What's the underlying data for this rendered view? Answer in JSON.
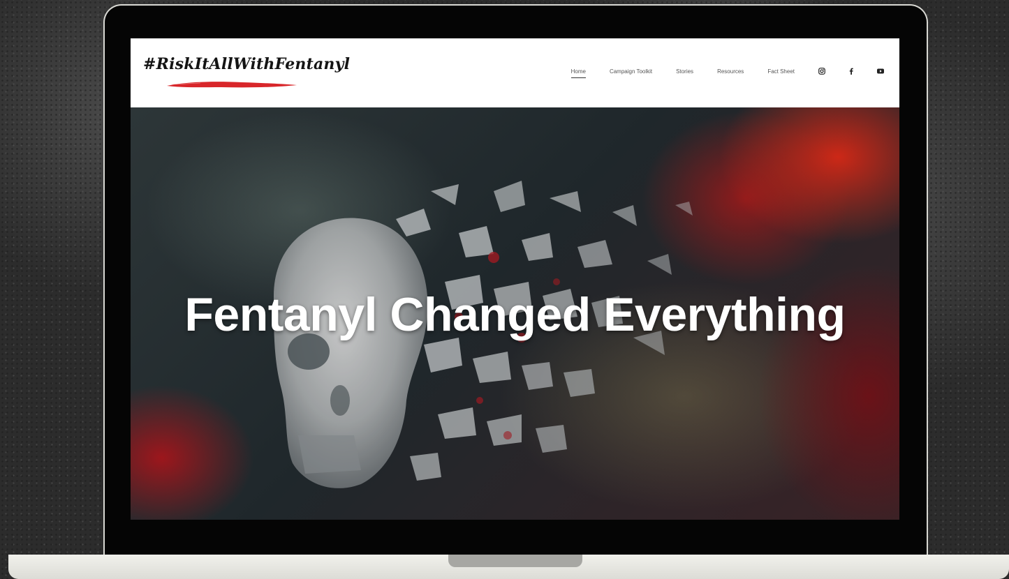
{
  "site": {
    "logo_text": "#RiskItAllWithFentanyl",
    "accent": "#d8262a"
  },
  "nav": {
    "items": [
      {
        "label": "Home",
        "active": true
      },
      {
        "label": "Campaign Toolkit",
        "active": false
      },
      {
        "label": "Stories",
        "active": false
      },
      {
        "label": "Resources",
        "active": false
      },
      {
        "label": "Fact Sheet",
        "active": false
      }
    ],
    "social": [
      "instagram-icon",
      "facebook-icon",
      "youtube-icon"
    ]
  },
  "hero": {
    "title": "Fentanyl Changed Everything",
    "image": "shattering-skull-icon"
  }
}
